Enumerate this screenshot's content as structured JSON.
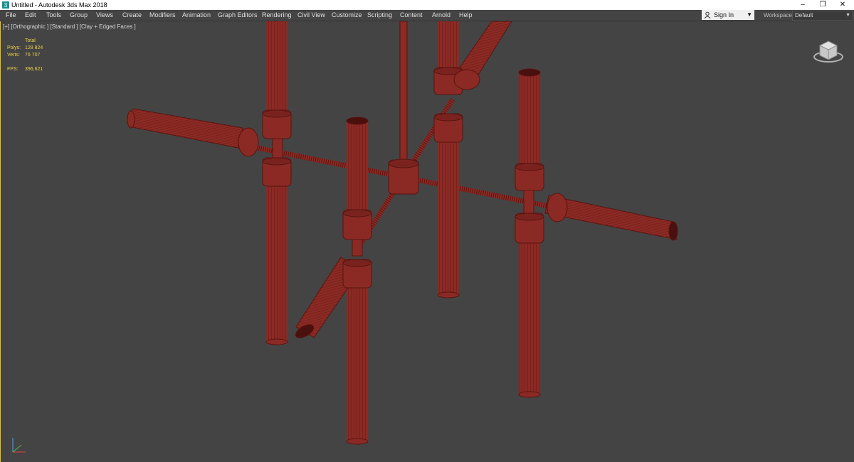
{
  "window": {
    "title": "Untitled - Autodesk 3ds Max 2018",
    "minimize": "–",
    "maximize": "❐",
    "close": "✕"
  },
  "menu": [
    {
      "label": "File"
    },
    {
      "label": "Edit"
    },
    {
      "label": "Tools"
    },
    {
      "label": "Group"
    },
    {
      "label": "Views"
    },
    {
      "label": "Create"
    },
    {
      "label": "Modifiers"
    },
    {
      "label": "Animation"
    },
    {
      "label": "Graph Editors"
    },
    {
      "label": "Rendering"
    },
    {
      "label": "Civil View"
    },
    {
      "label": "Customize"
    },
    {
      "label": "Scripting"
    },
    {
      "label": "Content"
    },
    {
      "label": "Arnold"
    },
    {
      "label": "Help"
    }
  ],
  "account": {
    "sign_in": "Sign In",
    "caret": "▼",
    "icon": "user-icon"
  },
  "workspaces": {
    "label": "Workspaces:",
    "value": "Default",
    "caret": "▼"
  },
  "viewport": {
    "label": "[+] [Orthographic ] [Standard ] [Clay + Edged Faces ]",
    "stats": {
      "total_label": "Total",
      "polys_label": "Polys:",
      "polys_value": "128 824",
      "verts_label": "Verts:",
      "verts_value": "76 707",
      "fps_label": "FPS:",
      "fps_value": "396,621"
    },
    "object_color": "#8b2a24",
    "wire_color": "#5a1410",
    "background_color": "#444444"
  },
  "icons": {
    "viewcube": "viewcube-icon",
    "axis": "axis-tripod-icon"
  }
}
